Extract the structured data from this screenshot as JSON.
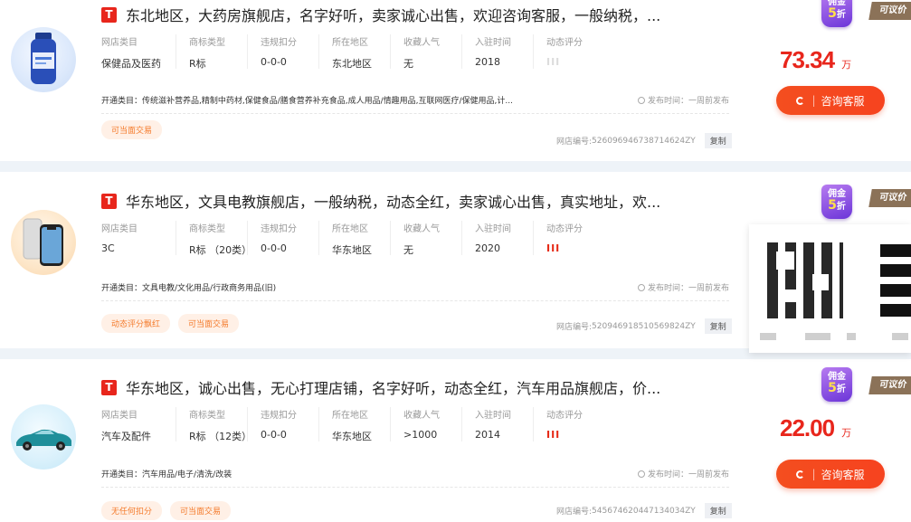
{
  "attr_labels": [
    "网店类目",
    "商标类型",
    "违规扣分",
    "所在地区",
    "收藏人气",
    "入驻时间",
    "动态评分"
  ],
  "labels": {
    "cats_prefix": "开通类目：",
    "publish": "发布时间：一周前发布",
    "shopid_prefix": "网店编号:",
    "copy": "复制",
    "consult": "咨询客服",
    "negotiable": "可议价",
    "badge_top": "佣金",
    "badge_num": "5",
    "badge_bot": "折",
    "tm_icon": "T",
    "unit": "万"
  },
  "colors": {
    "accent": "#e8261c",
    "tag_text": "#f47a2b",
    "badge": "#7c3fe0"
  },
  "listings": [
    {
      "thumb_icon": "supplement-bottle-icon",
      "title": "东北地区，大药房旗舰店，名字好听，卖家诚心出售，欢迎咨询客服，一般纳税，...",
      "attrs": [
        "保健品及医药",
        "R标",
        "0-0-0",
        "东北地区",
        "无",
        "2018"
      ],
      "rating": "III",
      "rating_color": "grey",
      "cats": "传统滋补营养品,精制中药材,保健食品/膳食营养补充食品,成人用品/情趣用品,互联网医疗/保健用品,计...",
      "tags": [
        "可当面交易"
      ],
      "shop_id": "526096946738714624ZY",
      "price": "73.34"
    },
    {
      "thumb_icon": "phone-product-icon",
      "title": "华东地区，文具电教旗舰店，一般纳税，动态全红，卖家诚心出售，真实地址，欢...",
      "attrs": [
        "3C",
        "R标 （20类）",
        "0-0-0",
        "华东地区",
        "无",
        "2020"
      ],
      "rating": "III",
      "rating_color": "red",
      "cats": "文具电教/文化用品/行政商务用品(旧)",
      "tags": [
        "动态评分飘红",
        "可当面交易"
      ],
      "shop_id": "520946918510569824ZY",
      "price": ""
    },
    {
      "thumb_icon": "car-product-icon",
      "title": "华东地区，诚心出售，无心打理店铺，名字好听，动态全红，汽车用品旗舰店，价...",
      "attrs": [
        "汽车及配件",
        "R标 （12类）",
        "0-0-0",
        "华东地区",
        ">1000",
        "2014"
      ],
      "rating": "III",
      "rating_color": "red",
      "cats": "汽车用品/电子/清洗/改装",
      "tags": [
        "无任何扣分",
        "可当面交易"
      ],
      "shop_id": "545674620447134034ZY",
      "price": "22.00"
    }
  ]
}
